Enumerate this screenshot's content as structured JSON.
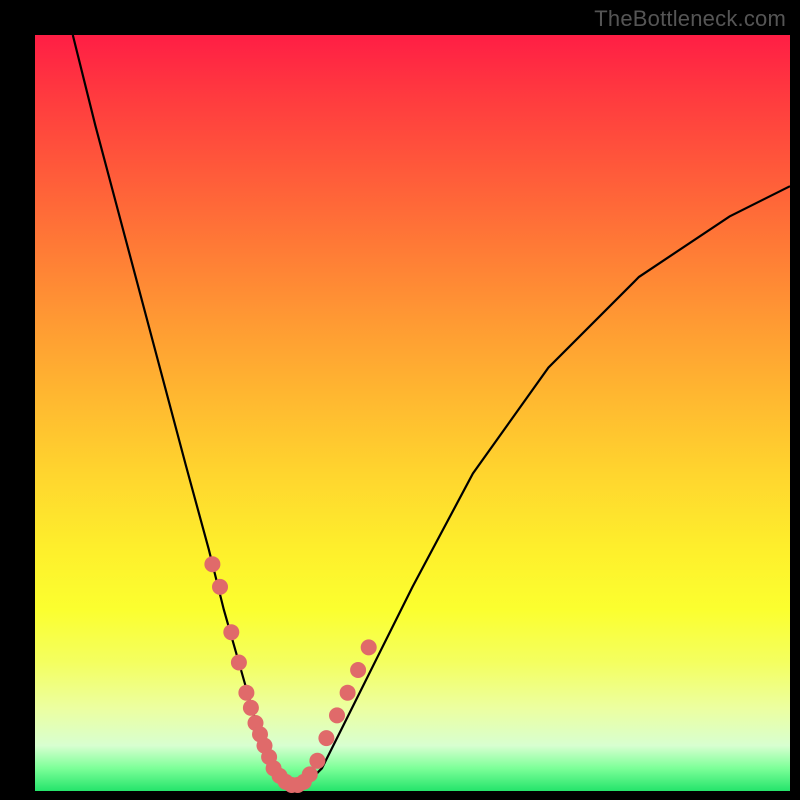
{
  "watermark": "TheBottleneck.com",
  "chart_data": {
    "type": "line",
    "title": "",
    "xlabel": "",
    "ylabel": "",
    "xlim": [
      0,
      100
    ],
    "ylim": [
      0,
      100
    ],
    "series": [
      {
        "name": "curve",
        "x": [
          5,
          8,
          12,
          16,
          20,
          23,
          25,
          27,
          29,
          30,
          31,
          32,
          33,
          34,
          35,
          36,
          38,
          40,
          44,
          50,
          58,
          68,
          80,
          92,
          100
        ],
        "y": [
          100,
          88,
          73,
          58,
          43,
          32,
          24,
          17,
          10,
          7,
          4,
          2,
          1,
          0.6,
          0.6,
          1,
          3,
          7,
          15,
          27,
          42,
          56,
          68,
          76,
          80
        ]
      }
    ],
    "markers": {
      "name": "highlight-dots",
      "color": "#e06a6a",
      "x": [
        23.5,
        24.5,
        26.0,
        27.0,
        28.0,
        28.6,
        29.2,
        29.8,
        30.4,
        31.0,
        31.6,
        32.4,
        33.2,
        34.0,
        34.8,
        35.6,
        36.4,
        37.4,
        38.6,
        40.0,
        41.4,
        42.8,
        44.2
      ],
      "y": [
        30.0,
        27.0,
        21.0,
        17.0,
        13.0,
        11.0,
        9.0,
        7.5,
        6.0,
        4.5,
        3.0,
        2.0,
        1.2,
        0.8,
        0.8,
        1.2,
        2.2,
        4.0,
        7.0,
        10.0,
        13.0,
        16.0,
        19.0
      ]
    }
  }
}
